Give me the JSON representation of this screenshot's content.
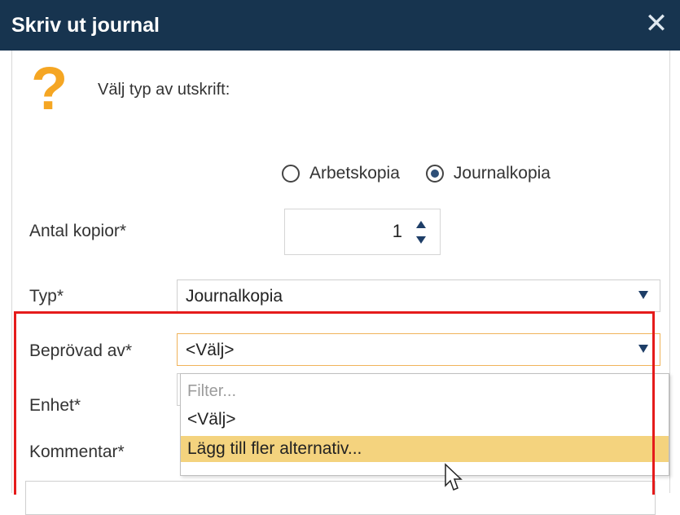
{
  "dialog": {
    "title": "Skriv ut journal"
  },
  "prompt": {
    "icon": "question-icon",
    "text": "Välj typ av utskrift:"
  },
  "print_type": {
    "options": [
      {
        "label": "Arbetskopia",
        "checked": false
      },
      {
        "label": "Journalkopia",
        "checked": true
      }
    ]
  },
  "copies": {
    "label": "Antal kopior*",
    "value": "1"
  },
  "type": {
    "label": "Typ*",
    "value": "Journalkopia"
  },
  "approved_by": {
    "label": "Beprövad av*",
    "value": "<Välj>",
    "dropdown": {
      "filter_placeholder": "Filter...",
      "options": [
        "<Välj>",
        "Lägg till fler alternativ..."
      ],
      "highlighted_index": 1
    }
  },
  "unit": {
    "label": "Enhet*"
  },
  "comment": {
    "label": "Kommentar*"
  },
  "colors": {
    "titlebar": "#17344f",
    "question_icon": "#f5a623",
    "highlight_border": "#e51b1b",
    "hover_option": "#f4d37e"
  }
}
